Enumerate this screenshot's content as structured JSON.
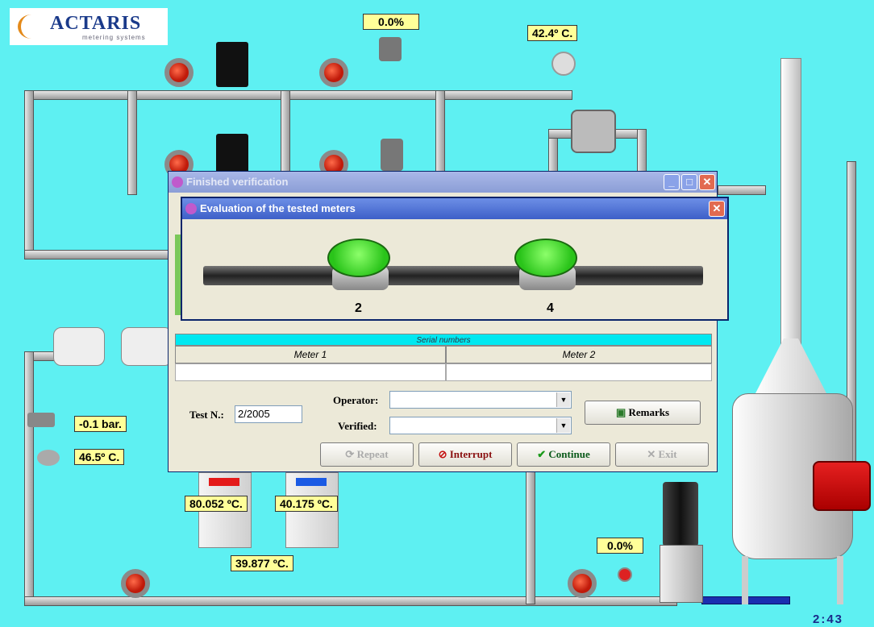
{
  "logo": {
    "brand": "ACTARIS",
    "tagline": "metering systems"
  },
  "readouts": {
    "top_percent": "0.0%",
    "top_temp": "42.4º C.",
    "pressure": "-0.1 bar.",
    "left_temp": "46.5º C.",
    "hot_bath": "80.052 ºC.",
    "cold_bath": "40.175 ºC.",
    "mix_temp": "39.877 ºC.",
    "pump_percent": "0.0%"
  },
  "clock": "2:43",
  "finished_window": {
    "title": "Finished verification",
    "serial_header": "Serial numbers",
    "meter1_label": "Meter 1",
    "meter2_label": "Meter 2",
    "meter1_serial": "",
    "meter2_serial": "",
    "test_label": "Test N.:",
    "test_value": "2/2005",
    "operator_label": "Operator:",
    "operator_value": "",
    "verified_label": "Verified:",
    "verified_value": "",
    "remarks_label": "Remarks",
    "repeat_label": "Repeat",
    "interrupt_label": "Interrupt",
    "continue_label": "Continue",
    "exit_label": "Exit"
  },
  "evaluation_window": {
    "title": "Evaluation of the tested meters",
    "meters": [
      {
        "number": "2"
      },
      {
        "number": "4"
      }
    ]
  },
  "colors": {
    "background": "#5ef0f2",
    "readout": "#ffff99",
    "meter_pass": "#2ac41a"
  }
}
